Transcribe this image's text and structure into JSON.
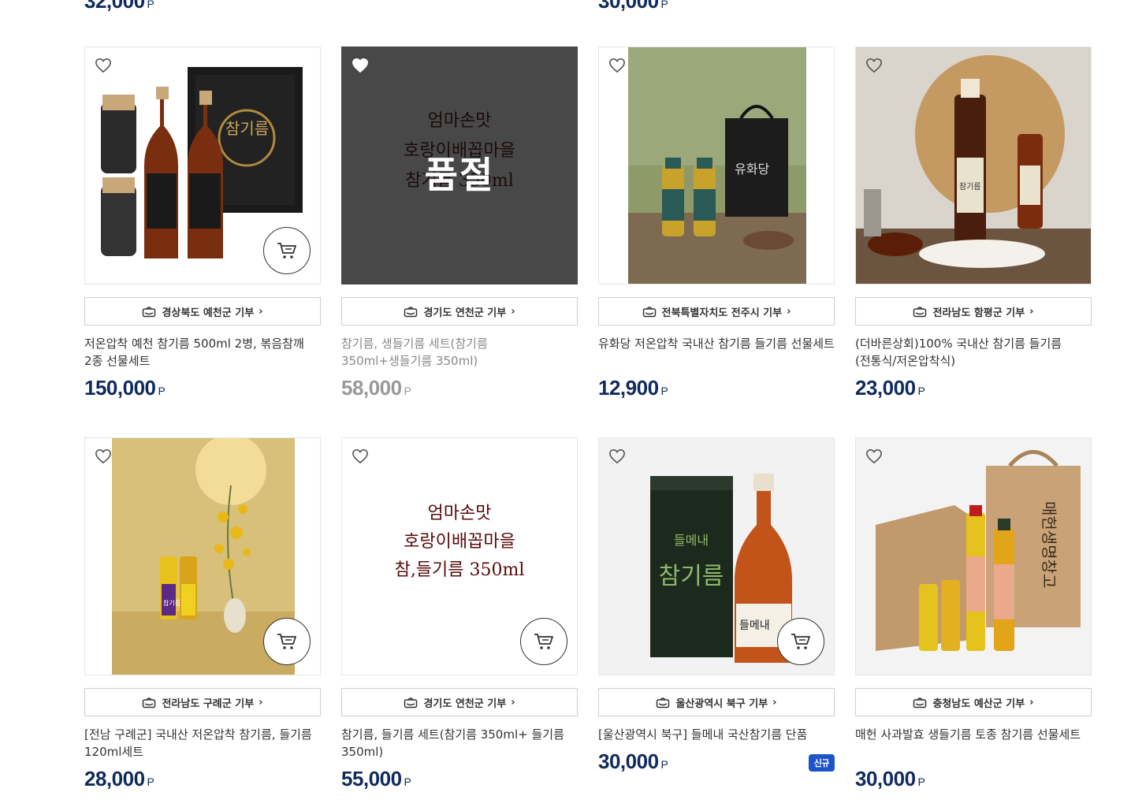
{
  "top_prices": [
    {
      "value": "32,000",
      "unit": "P"
    },
    {
      "value": "30,000",
      "unit": "P"
    }
  ],
  "colors": {
    "price": "#0f2a5c",
    "badge_new": "#1d55c8"
  },
  "products": [
    {
      "region": "경상북도 예천군 기부",
      "title": "저온압착 예천 참기름 500ml 2병, 볶음참깨 2종 선물세트",
      "price": "150,000",
      "unit": "P",
      "image_text": "참기름"
    },
    {
      "region": "경기도 연천군 기부",
      "title": "참기름, 생들기름 세트(참기름 350ml+생들기름 350ml)",
      "price": "58,000",
      "unit": "P",
      "soldout": "품절",
      "image_lines": [
        "엄마손맛",
        "호랑이배꼽마을",
        "참기름 350ml"
      ]
    },
    {
      "region": "전북특별자치도 전주시 기부",
      "title": "유화당 저온압착 국내산 참기름 들기름 선물세트",
      "price": "12,900",
      "unit": "P",
      "image_text": "유화당"
    },
    {
      "region": "전라남도 함평군 기부",
      "title": "(더바른상회)100% 국내산 참기름 들기름 (전통식/저온압착식)",
      "price": "23,000",
      "unit": "P",
      "image_text": "참기름"
    },
    {
      "region": "전라남도 구례군 기부",
      "title": "[전남 구례군] 국내산 저온압착 참기름, 들기름 120ml세트",
      "price": "28,000",
      "unit": "P",
      "image_text": "참기름"
    },
    {
      "region": "경기도 연천군 기부",
      "title": "참기름, 들기름 세트(참기름 350ml+ 들기름 350ml)",
      "price": "55,000",
      "unit": "P",
      "image_lines": [
        "엄마손맛",
        "호랑이배꼽마을",
        "참,들기름 350ml"
      ]
    },
    {
      "region": "울산광역시 북구 기부",
      "title": "[울산광역시 북구] 들메내 국산참기름 단품",
      "price": "30,000",
      "unit": "P",
      "badge": "신규",
      "image_lines": [
        "들메내",
        "참기름",
        "들메내"
      ]
    },
    {
      "region": "충청남도 예산군 기부",
      "title": "매헌 사과발효 생들기름 토종 참기름 선물세트",
      "price": "30,000",
      "unit": "P",
      "image_text": "매헌생명창고"
    }
  ]
}
